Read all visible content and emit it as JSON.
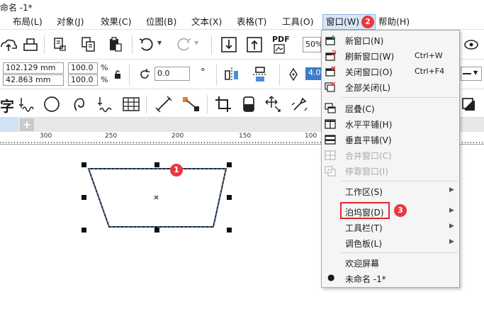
{
  "window": {
    "title": "命名 -1*"
  },
  "menubar": {
    "items": [
      {
        "label": "布局(L)"
      },
      {
        "label": "对象(J)"
      },
      {
        "label": "效果(C)"
      },
      {
        "label": "位图(B)"
      },
      {
        "label": "文本(X)"
      },
      {
        "label": "表格(T)"
      },
      {
        "label": "工具(O)"
      },
      {
        "label": "窗口(W)"
      },
      {
        "label": "帮助(H)"
      }
    ]
  },
  "badges": {
    "step1": "1",
    "step2": "2",
    "step3": "3"
  },
  "property_bar": {
    "x_value": "102.129 mm",
    "y_value": "42.863 mm",
    "scale_w": "100.0",
    "scale_h": "100.0",
    "percent": "%",
    "rotation": "0.0",
    "degree": "°",
    "outline_width": "4.0"
  },
  "toolbar": {
    "zoom_value": "50%",
    "pdf_label": "PDF"
  },
  "ruler": {
    "labels": [
      "300",
      "250",
      "200",
      "150",
      "100"
    ]
  },
  "window_menu": {
    "items": [
      {
        "label": "新窗口(N)",
        "shortcut": "",
        "icon": "new-window-icon",
        "disabled": false
      },
      {
        "label": "刷新窗口(W)",
        "shortcut": "Ctrl+W",
        "icon": "refresh-window-icon",
        "disabled": false
      },
      {
        "label": "关闭窗口(O)",
        "shortcut": "Ctrl+F4",
        "icon": "close-window-icon",
        "disabled": false
      },
      {
        "label": "全部关闭(L)",
        "shortcut": "",
        "icon": "close-all-icon",
        "disabled": false
      },
      {
        "label": "层叠(C)",
        "shortcut": "",
        "icon": "cascade-icon",
        "disabled": false
      },
      {
        "label": "水平平铺(H)",
        "shortcut": "",
        "icon": "tile-horizontal-icon",
        "disabled": false
      },
      {
        "label": "垂直平铺(V)",
        "shortcut": "",
        "icon": "tile-vertical-icon",
        "disabled": false
      },
      {
        "label": "合并窗口(C)",
        "shortcut": "",
        "icon": "combine-window-icon",
        "disabled": true
      },
      {
        "label": "停靠窗口(I)",
        "shortcut": "",
        "icon": "dock-window-icon",
        "disabled": true
      },
      {
        "label": "工作区(S)",
        "submenu": true
      },
      {
        "label": "泊坞窗(D)",
        "submenu": true
      },
      {
        "label": "工具栏(T)",
        "submenu": true
      },
      {
        "label": "调色板(L)",
        "submenu": true
      },
      {
        "label": "欢迎屏幕"
      },
      {
        "label": "未命名 -1*",
        "checked": true
      }
    ]
  },
  "colors": {
    "accent_red": "#e6393f",
    "menu_highlight": "#d6e6f7",
    "selection_blue": "#4a8fd8"
  }
}
